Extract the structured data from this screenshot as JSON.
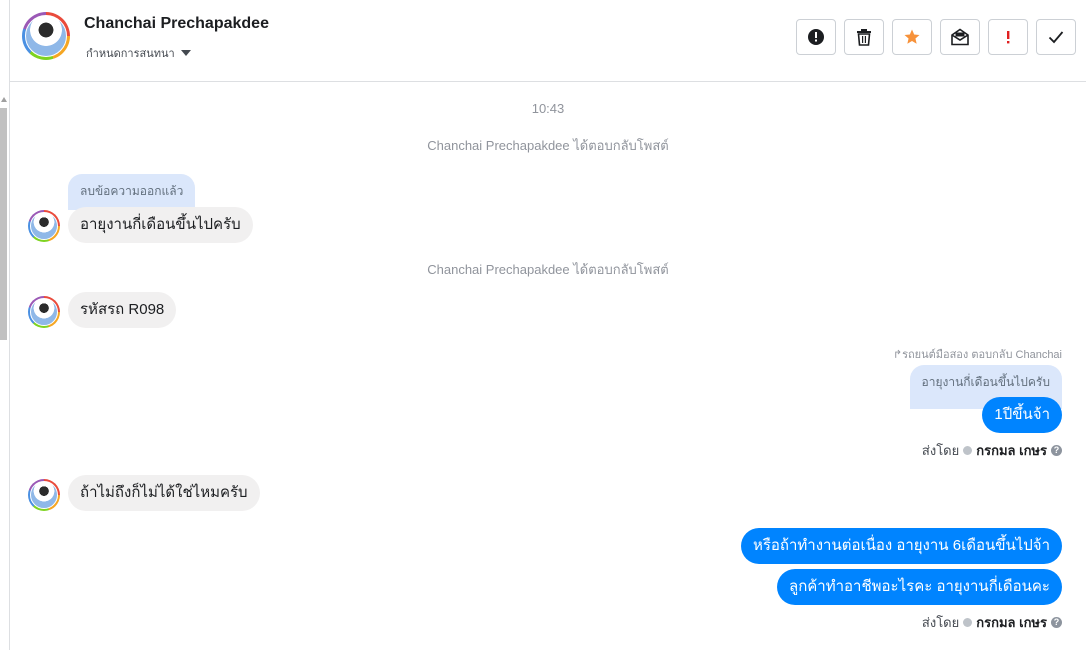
{
  "header": {
    "contact_name": "Chanchai Prechapakdee",
    "conversation_settings": "กำหนดการสนทนา"
  },
  "toolbar": {
    "buttons": [
      "alert-icon",
      "trash-icon",
      "star-icon",
      "mark-unread-icon",
      "important-icon",
      "done-icon"
    ]
  },
  "messages": {
    "time": "10:43",
    "sys1": "Chanchai Prechapakdee ได้ตอบกลับโพสต์",
    "quote1": "ลบข้อความออกแล้ว",
    "msg1": "อายุงานกี่เดือนขึ้นไปครับ",
    "sys2": "Chanchai Prechapakdee ได้ตอบกลับโพสต์",
    "msg2": "รหัสรถ R098",
    "reply_note": "รถยนต์มือสอง ตอบกลับ Chanchai",
    "quote2": "อายุงานกี่เดือนขึ้นไปครับ",
    "out1": "1ปีขึ้นจ้า",
    "sent_by_label": "ส่งโดย",
    "sender_name": "กรกมล เกษร",
    "msg3": "ถ้าไม่ถึงก็ไม่ได้ใช่ไหมครับ",
    "out2": "หรือถ้าทำงานต่อเนื่อง อายุงาน 6เดือนขึ้นไปจ้า",
    "out3": "ลูกค้าทำอาชีพอะไรคะ อายุงานกี่เดือนคะ",
    "sent_by_label2": "ส่งโดย",
    "sender_name2": "กรกมล เกษร"
  },
  "colors": {
    "outgoing_bubble": "#0084ff",
    "incoming_bubble": "#f1f0f0",
    "quote_bubble": "#dbe7fb",
    "star": "#f7923a",
    "important": "#e02020"
  }
}
